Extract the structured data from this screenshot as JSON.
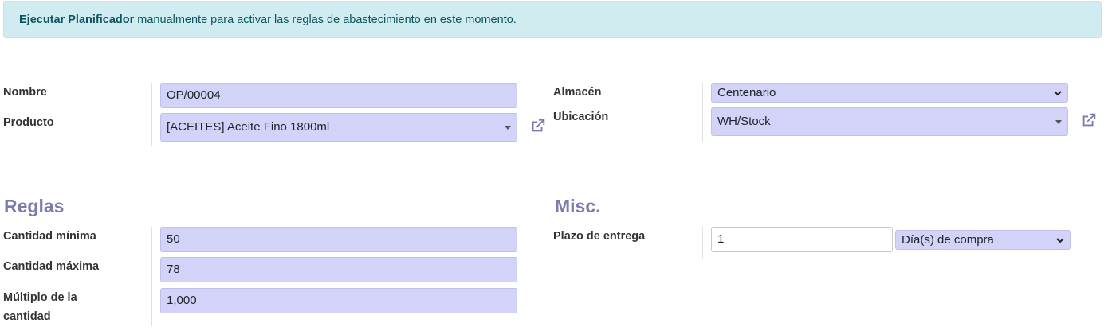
{
  "alert": {
    "bold": "Ejecutar Planificador",
    "text": " manualmente para activar las reglas de abastecimiento en este momento."
  },
  "fields": {
    "nombre": {
      "label": "Nombre",
      "value": "OP/00004"
    },
    "producto": {
      "label": "Producto",
      "value": "[ACEITES] Aceite Fino 1800ml"
    },
    "almacen": {
      "label": "Almacén",
      "value": "Centenario"
    },
    "ubicacion": {
      "label": "Ubicación",
      "value": "WH/Stock"
    }
  },
  "sections": {
    "reglas": "Reglas",
    "misc": "Misc."
  },
  "reglas": {
    "cant_min": {
      "label": "Cantidad mínima",
      "value": "50"
    },
    "cant_max": {
      "label": "Cantidad máxima",
      "value": "78"
    },
    "multiplo": {
      "label_line1": "Múltiplo de la",
      "label_line2": "cantidad",
      "value": "1,000"
    }
  },
  "misc": {
    "plazo": {
      "label": "Plazo de entrega",
      "value": "1",
      "unit": "Día(s) de compra"
    }
  },
  "icons": {
    "external_link": "external-link-icon",
    "dropdown": "caret-down-icon"
  },
  "colors": {
    "field_bg": "#d3d2f9",
    "section_title": "#7c7bad",
    "alert_bg": "#d1ecf1"
  }
}
